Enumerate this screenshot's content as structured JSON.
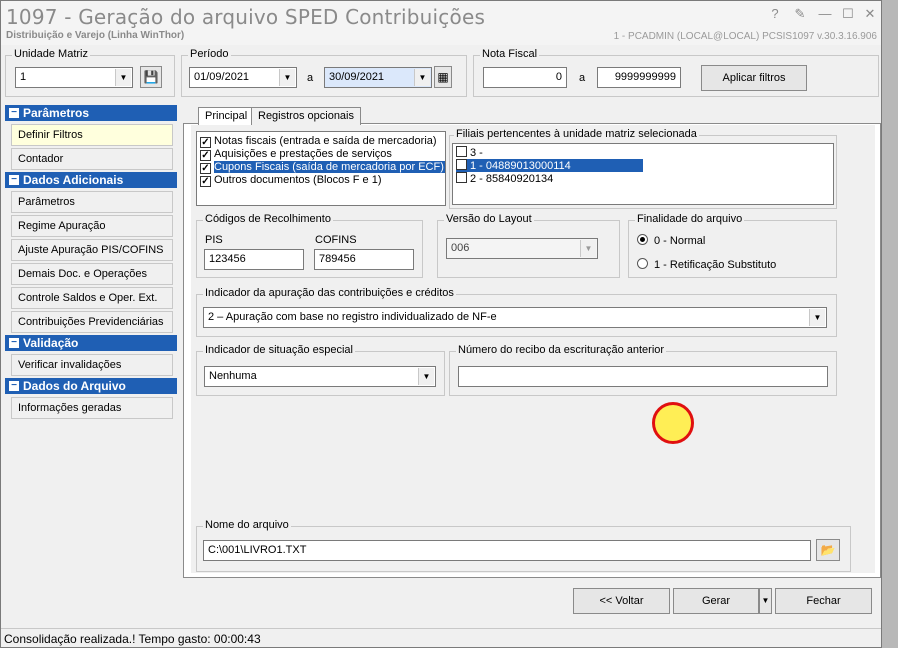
{
  "window": {
    "title": "1097 - Geração do arquivo SPED Contribuições",
    "subtitle": "Distribuição e Varejo (Linha WinThor)",
    "userinfo": "1 - PCADMIN (LOCAL@LOCAL)    PCSIS1097  v.30.3.16.906"
  },
  "filters": {
    "unidade_label": "Unidade Matriz",
    "unidade_value": "1",
    "periodo_label": "Período",
    "date_from": "01/09/2021",
    "date_sep": "a",
    "date_to": "30/09/2021",
    "nota_label": "Nota Fiscal",
    "nota_from": "0",
    "nota_sep": "a",
    "nota_to": "9999999999",
    "apply_label": "Aplicar filtros"
  },
  "sidebar": {
    "sections": [
      {
        "title": "Parâmetros",
        "items": [
          "Definir Filtros",
          "Contador"
        ]
      },
      {
        "title": "Dados Adicionais",
        "items": [
          "Parâmetros",
          "Regime Apuração",
          "Ajuste Apuração PIS/COFINS",
          "Demais Doc. e Operações",
          "Controle Saldos e Oper. Ext.",
          "Contribuições Previdenciárias"
        ]
      },
      {
        "title": "Validação",
        "items": [
          "Verificar invalidações"
        ]
      },
      {
        "title": "Dados do Arquivo",
        "items": [
          "Informações geradas"
        ]
      }
    ]
  },
  "tabs": [
    "Principal",
    "Registros opcionais"
  ],
  "docs": {
    "items": [
      {
        "label": "Notas fiscais (entrada e saída de mercadoria)",
        "checked": true
      },
      {
        "label": "Aquisições e prestações de serviços",
        "checked": true
      },
      {
        "label": "Cupons Fiscais (saída de mercadoria por ECF)",
        "checked": true
      },
      {
        "label": "Outros documentos (Blocos F e 1)",
        "checked": true
      }
    ]
  },
  "filiais": {
    "label": "Filiais pertencentes à unidade matriz selecionada",
    "items": [
      "3 -",
      "1 - 04889013000114",
      "2 - 85840920134"
    ]
  },
  "codigos": {
    "label": "Códigos de Recolhimento",
    "pis_label": "PIS",
    "pis_value": "123456",
    "cofins_label": "COFINS",
    "cofins_value": "789456"
  },
  "versao": {
    "label": "Versão do Layout",
    "value": "006"
  },
  "finalidade": {
    "label": "Finalidade do arquivo",
    "options": [
      "0 - Normal",
      "1 - Retificação Substituto"
    ]
  },
  "indicador": {
    "label": "Indicador da apuração das contribuições e créditos",
    "value": "2 – Apuração com base no registro individualizado de NF-e"
  },
  "situacao": {
    "label": "Indicador de situação especial",
    "value": "Nenhuma"
  },
  "recibo": {
    "label": "Número do recibo da escrituração anterior",
    "value": ""
  },
  "arquivo": {
    "label": "Nome do arquivo",
    "value": "C:\\001\\LIVRO1.TXT"
  },
  "actions": {
    "voltar": "<< Voltar",
    "gerar": "Gerar",
    "fechar": "Fechar"
  },
  "status": "Consolidação realizada.! Tempo gasto: 00:00:43"
}
